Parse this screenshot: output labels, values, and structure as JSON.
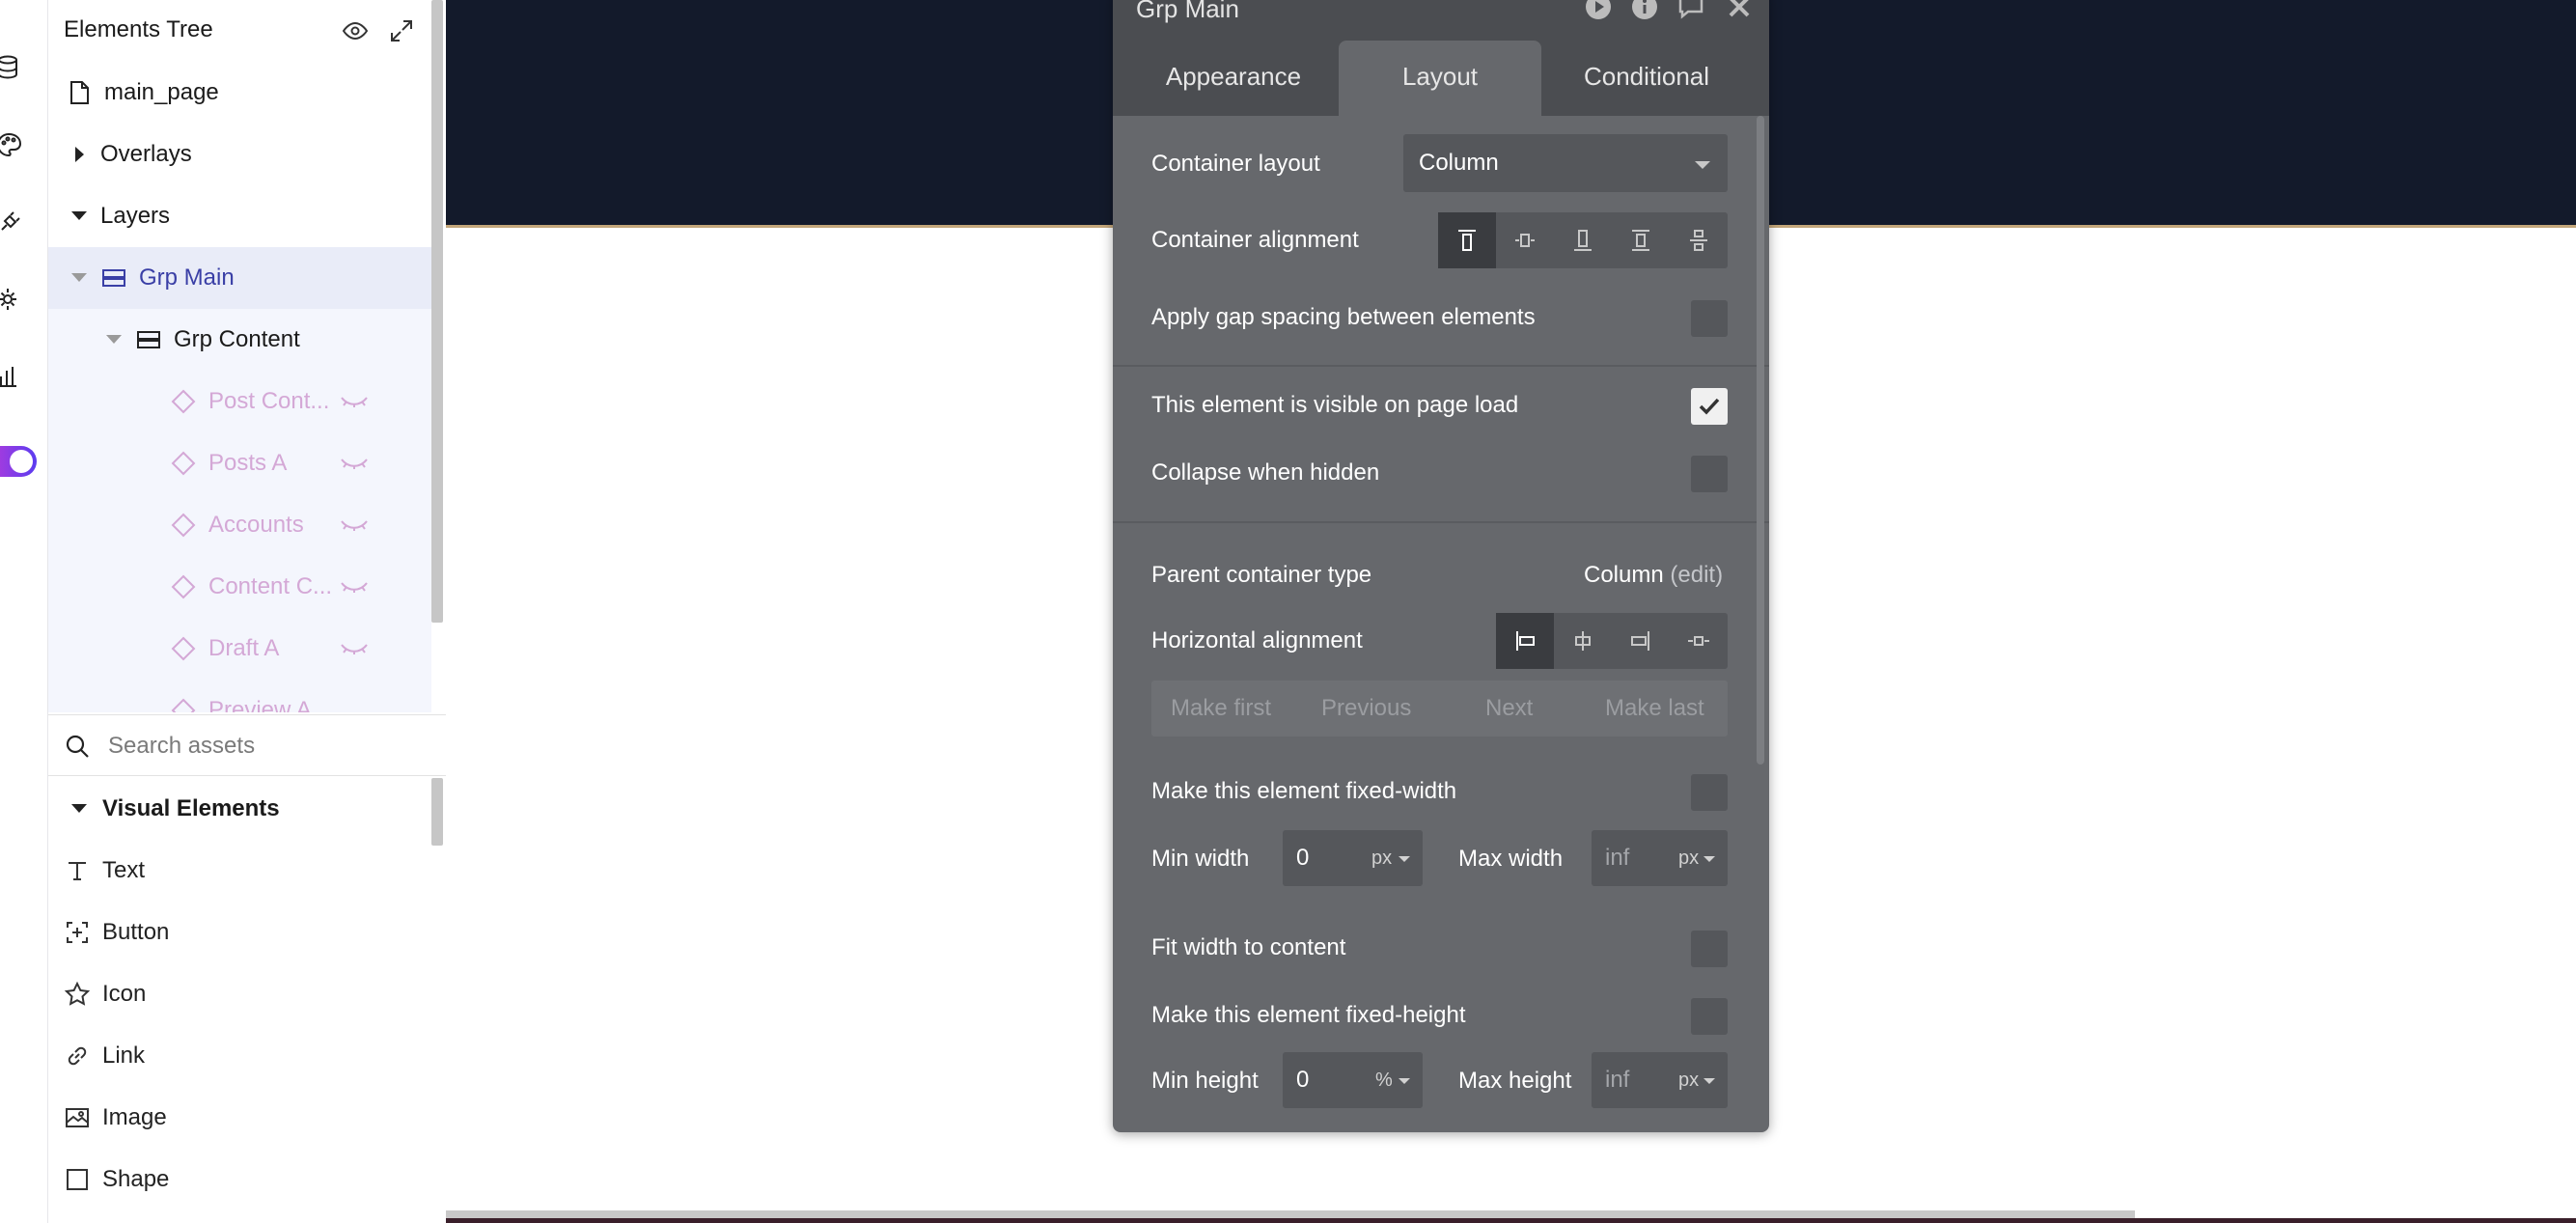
{
  "tree": {
    "title": "Elements Tree",
    "page": "main_page",
    "overlays": "Overlays",
    "layers": "Layers",
    "grp_main": "Grp Main",
    "grp_content": "Grp Content",
    "children": [
      "Post Cont...",
      "Posts A",
      "Accounts",
      "Content C...",
      "Draft A",
      "Preview A"
    ]
  },
  "search": {
    "placeholder": "Search assets"
  },
  "visual": {
    "heading": "Visual Elements",
    "items": [
      "Text",
      "Button",
      "Icon",
      "Link",
      "Image",
      "Shape"
    ]
  },
  "editor": {
    "title": "Grp Main",
    "tabs": [
      "Appearance",
      "Layout",
      "Conditional"
    ],
    "container_layout_label": "Container layout",
    "container_layout_value": "Column",
    "container_alignment_label": "Container alignment",
    "gap_label": "Apply gap spacing between elements",
    "visible_label": "This element is visible on page load",
    "collapse_label": "Collapse when hidden",
    "parent_type_label": "Parent container type",
    "parent_type_value": "Column",
    "parent_type_edit": "(edit)",
    "horizontal_alignment_label": "Horizontal alignment",
    "nav": [
      "Make first",
      "Previous",
      "Next",
      "Make last"
    ],
    "fixed_width_label": "Make this element fixed-width",
    "min_width_label": "Min width",
    "min_width_value": "0",
    "min_width_unit": "px",
    "max_width_label": "Max width",
    "max_width_placeholder": "inf",
    "max_width_unit": "px",
    "fit_width_label": "Fit width to content",
    "fixed_height_label": "Make this element fixed-height",
    "min_height_label": "Min height",
    "min_height_value": "0",
    "min_height_unit": "%",
    "max_height_label": "Max height",
    "max_height_placeholder": "inf",
    "max_height_unit": "px",
    "checks": {
      "gap": false,
      "visible": true,
      "collapse": false,
      "fixed_width": false,
      "fit_width": false,
      "fixed_height": false
    }
  },
  "colors": {
    "header_band": "#131a2b",
    "editor_bg": "#66686c",
    "selected_row": "#e9ecf8",
    "hidden_element": "#d4a8d6"
  }
}
